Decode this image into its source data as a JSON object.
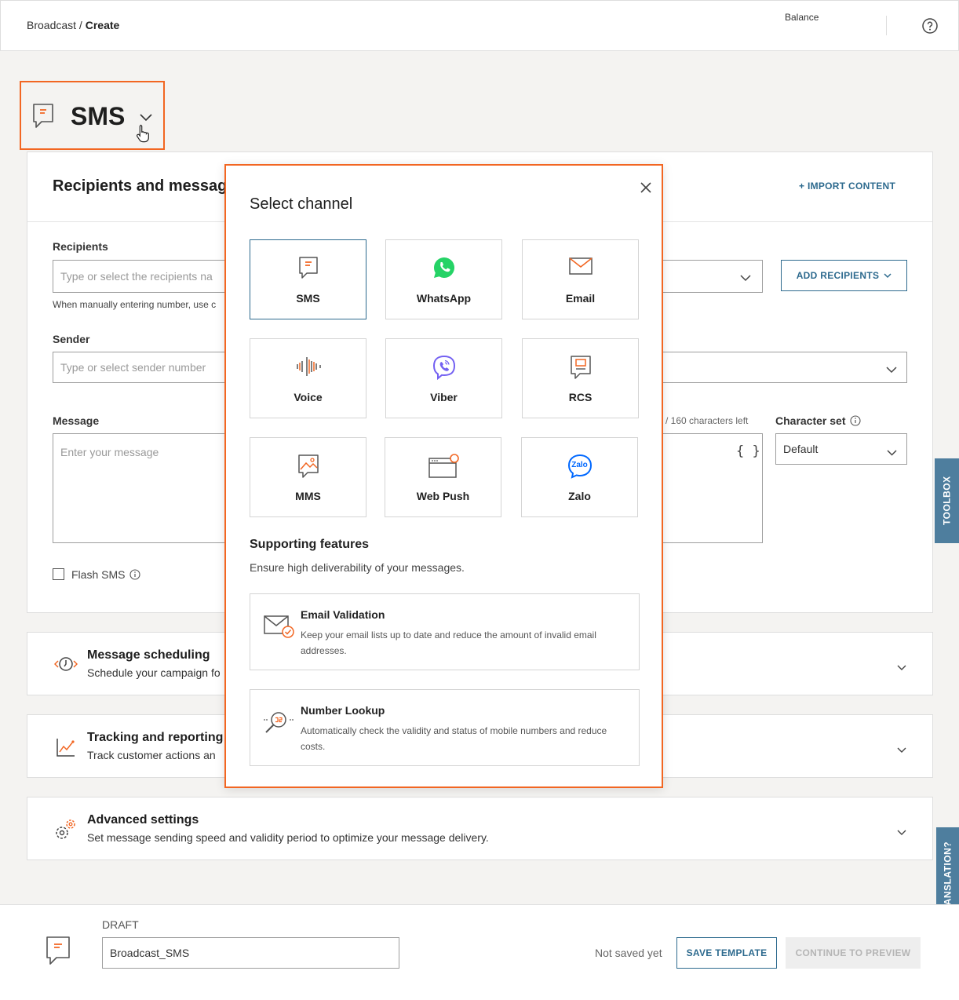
{
  "header": {
    "breadcrumb_root": "Broadcast",
    "breadcrumb_sep": " / ",
    "breadcrumb_current": "Create",
    "balance_label": "Balance"
  },
  "channel_selector": {
    "label": "SMS"
  },
  "recipients_section": {
    "title": "Recipients and messag",
    "import_label": "+ IMPORT CONTENT",
    "recipients_label": "Recipients",
    "recipients_placeholder": "Type or select the recipients na",
    "recipients_hint": "When manually entering number, use c",
    "add_recipients_label": "ADD RECIPIENTS",
    "sender_label": "Sender",
    "sender_placeholder": "Type or select sender number",
    "message_label": "Message",
    "message_placeholder": "Enter your message",
    "char_counter": "e / 160 characters left",
    "charset_label": "Character set",
    "charset_value": "Default",
    "placeholder_glyph": "{ }",
    "flash_label": "Flash SMS"
  },
  "sections": [
    {
      "title": "Message scheduling",
      "subtitle": "Schedule your campaign fo"
    },
    {
      "title": "Tracking and reporting",
      "subtitle": "Track customer actions an"
    },
    {
      "title": "Advanced settings",
      "subtitle": "Set message sending speed and validity period to optimize your message delivery."
    }
  ],
  "side_tabs": {
    "toolbox": "TOOLBOX",
    "translation": "LOST IN TRANSLATION?"
  },
  "footer": {
    "draft_label": "DRAFT",
    "draft_name": "Broadcast_SMS",
    "save_status": "Not saved yet",
    "save_template": "SAVE TEMPLATE",
    "continue_label": "CONTINUE TO PREVIEW"
  },
  "modal": {
    "title": "Select channel",
    "channels": [
      {
        "label": "SMS",
        "icon": "sms-icon",
        "selected": true
      },
      {
        "label": "WhatsApp",
        "icon": "whatsapp-icon",
        "selected": false
      },
      {
        "label": "Email",
        "icon": "email-icon",
        "selected": false
      },
      {
        "label": "Voice",
        "icon": "voice-icon",
        "selected": false
      },
      {
        "label": "Viber",
        "icon": "viber-icon",
        "selected": false
      },
      {
        "label": "RCS",
        "icon": "rcs-icon",
        "selected": false
      },
      {
        "label": "MMS",
        "icon": "mms-icon",
        "selected": false
      },
      {
        "label": "Web Push",
        "icon": "web-push-icon",
        "selected": false
      },
      {
        "label": "Zalo",
        "icon": "zalo-icon",
        "selected": false
      }
    ],
    "features_title": "Supporting features",
    "features_subtitle": "Ensure high deliverability of your messages.",
    "features": [
      {
        "title": "Email Validation",
        "description": "Keep your email lists up to date and reduce the amount of invalid email addresses."
      },
      {
        "title": "Number Lookup",
        "description": "Automatically check the validity and status of mobile numbers and reduce costs."
      }
    ],
    "zalo_logo_text": "Zalo"
  },
  "colors": {
    "accent_orange": "#f26622",
    "primary_blue": "#2d6a8e",
    "whatsapp_green": "#25d366",
    "viber_purple": "#7360f2",
    "zalo_blue": "#0068ff",
    "side_tab": "#4e7e9e"
  }
}
